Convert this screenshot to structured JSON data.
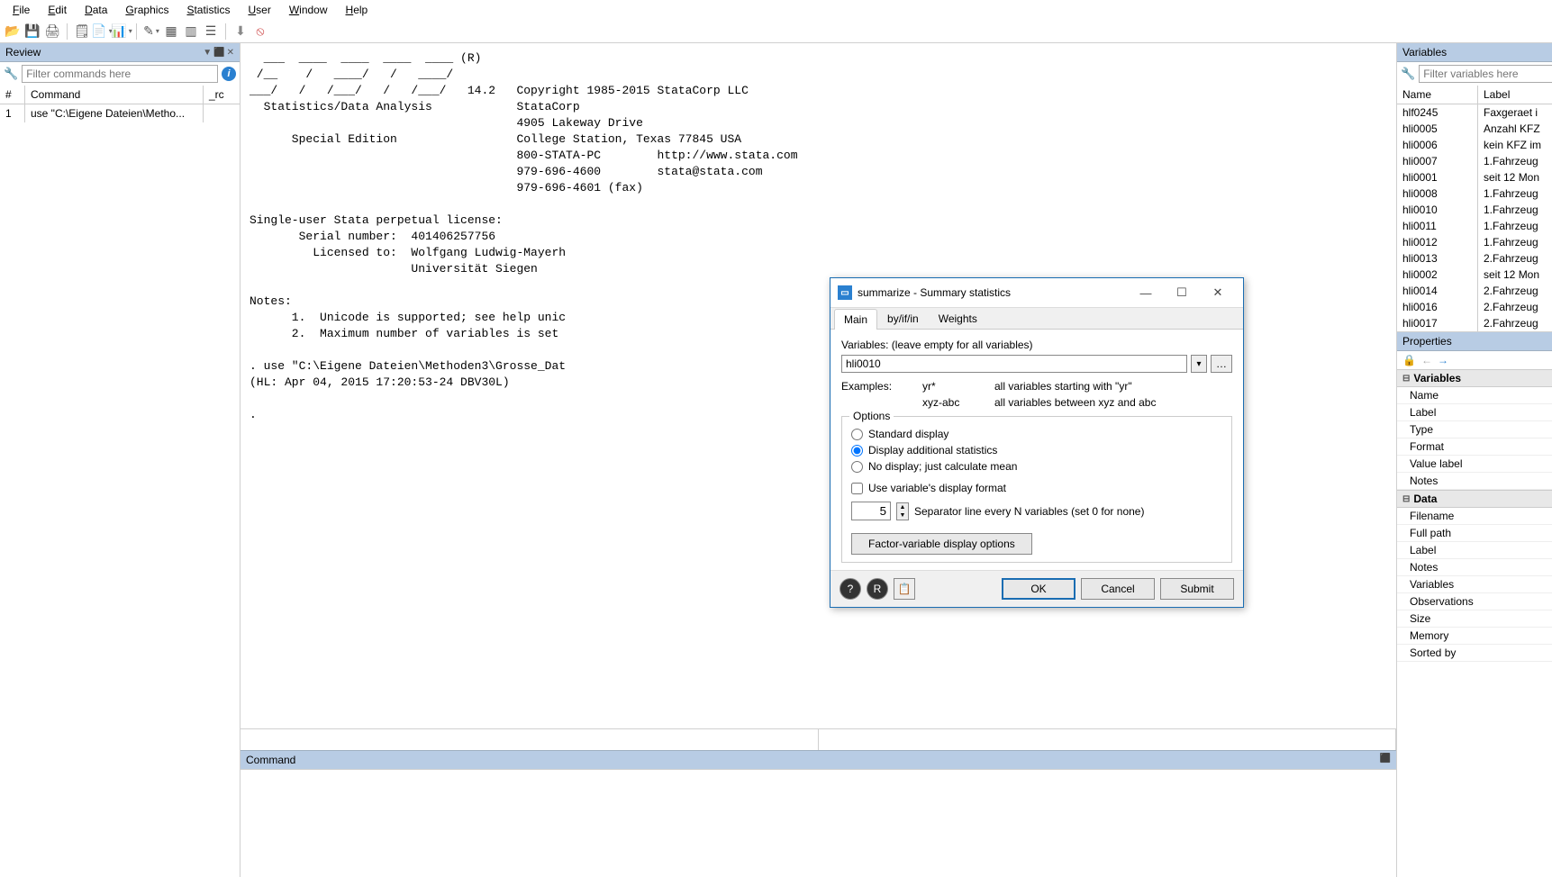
{
  "menu": [
    "File",
    "Edit",
    "Data",
    "Graphics",
    "Statistics",
    "User",
    "Window",
    "Help"
  ],
  "menu_underline_idx": [
    0,
    0,
    0,
    0,
    0,
    0,
    0,
    0
  ],
  "review": {
    "title": "Review",
    "filter_placeholder": "Filter commands here",
    "cols": {
      "n": "#",
      "cmd": "Command",
      "rc": "_rc"
    },
    "rows": [
      {
        "n": "1",
        "cmd": "use \"C:\\Eigene Dateien\\Metho...",
        "rc": ""
      }
    ]
  },
  "results": {
    "logo": [
      "  ___  ____  ____  ____  ____ (R)",
      " /__    /   ____/   /   ____/",
      "___/   /   /___/   /   /___/   14.2   Copyright 1985-2015 StataCorp LLC",
      "  Statistics/Data Analysis            StataCorp",
      "                                      4905 Lakeway Drive",
      "      Special Edition                 College Station, Texas 77845 USA",
      "                                      800-STATA-PC        http://www.stata.com",
      "                                      979-696-4600        stata@stata.com",
      "                                      979-696-4601 (fax)",
      "",
      "Single-user Stata perpetual license:",
      "       Serial number:  401406257756",
      "         Licensed to:  Wolfgang Ludwig-Mayerh",
      "                       Universität Siegen",
      "",
      "Notes:",
      "      1.  Unicode is supported; see help unic",
      "      2.  Maximum number of variables is set ",
      "",
      ". use \"C:\\Eigene Dateien\\Methoden3\\Grosse_Dat",
      "(HL: Apr 04, 2015 17:20:53-24 DBV30L)",
      "",
      "."
    ]
  },
  "command": {
    "title": "Command"
  },
  "variables": {
    "title": "Variables",
    "filter_placeholder": "Filter variables here",
    "cols": {
      "name": "Name",
      "label": "Label"
    },
    "rows": [
      {
        "name": "hlf0245",
        "label": "Faxgeraet i"
      },
      {
        "name": "hli0005",
        "label": "Anzahl KFZ"
      },
      {
        "name": "hli0006",
        "label": "kein KFZ im"
      },
      {
        "name": "hli0007",
        "label": "1.Fahrzeug "
      },
      {
        "name": "hli0001",
        "label": "seit 12 Mon"
      },
      {
        "name": "hli0008",
        "label": "1.Fahrzeug "
      },
      {
        "name": "hli0010",
        "label": "1.Fahrzeug "
      },
      {
        "name": "hli0011",
        "label": "1.Fahrzeug "
      },
      {
        "name": "hli0012",
        "label": "1.Fahrzeug "
      },
      {
        "name": "hli0013",
        "label": "2.Fahrzeug "
      },
      {
        "name": "hli0002",
        "label": "seit 12 Mon"
      },
      {
        "name": "hli0014",
        "label": "2.Fahrzeug "
      },
      {
        "name": "hli0016",
        "label": "2.Fahrzeug "
      },
      {
        "name": "hli0017",
        "label": "2.Fahrzeug "
      }
    ]
  },
  "properties": {
    "title": "Properties",
    "sec_variables": "Variables",
    "sec_data": "Data",
    "var_rows": [
      "Name",
      "Label",
      "Type",
      "Format",
      "Value label",
      "Notes"
    ],
    "data_rows": [
      "Filename",
      "   Full path",
      "Label",
      "Notes",
      "Variables",
      "Observations",
      "Size",
      "Memory",
      "Sorted by"
    ]
  },
  "dialog": {
    "title": "summarize - Summary statistics",
    "tabs": [
      "Main",
      "by/if/in",
      "Weights"
    ],
    "var_label": "Variables: (leave empty for all variables)",
    "var_value": "hli0010",
    "examples_label": "Examples:",
    "examples": [
      {
        "pat": "yr*",
        "desc": "all variables starting with \"yr\""
      },
      {
        "pat": "xyz-abc",
        "desc": "all variables between xyz and abc"
      }
    ],
    "options_label": "Options",
    "radio": [
      "Standard display",
      "Display additional statistics",
      "No display; just calculate mean"
    ],
    "radio_selected": 1,
    "check": "Use variable's display format",
    "separator_value": "5",
    "separator_label": "Separator line every N variables (set 0 for none)",
    "factor_btn": "Factor-variable display options",
    "buttons": {
      "ok": "OK",
      "cancel": "Cancel",
      "submit": "Submit"
    }
  }
}
